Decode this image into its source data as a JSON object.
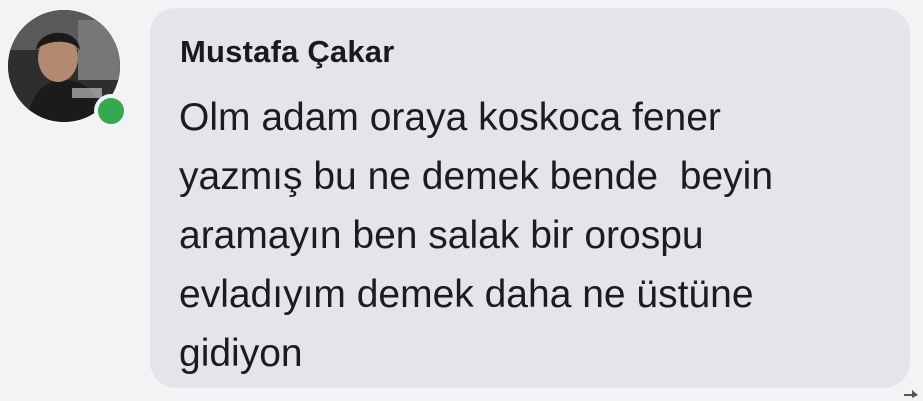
{
  "post": {
    "author": "Mustafa Çakar",
    "online": true,
    "message_lines": [
      "Olm adam oraya koskoca fener",
      "yazmış bu ne demek bende  beyin",
      "aramayın ben salak bir orospu",
      "evladıyım demek daha ne üstüne",
      "gidiyon"
    ]
  },
  "colors": {
    "bubble_background": "#e3e5ea",
    "page_background": "#f3f3f5",
    "online_indicator": "#35a852",
    "text": "#1c1c1c"
  },
  "icons": {
    "avatar": "profile-photo",
    "presence": "online-dot",
    "corner": "arrow-icon"
  }
}
